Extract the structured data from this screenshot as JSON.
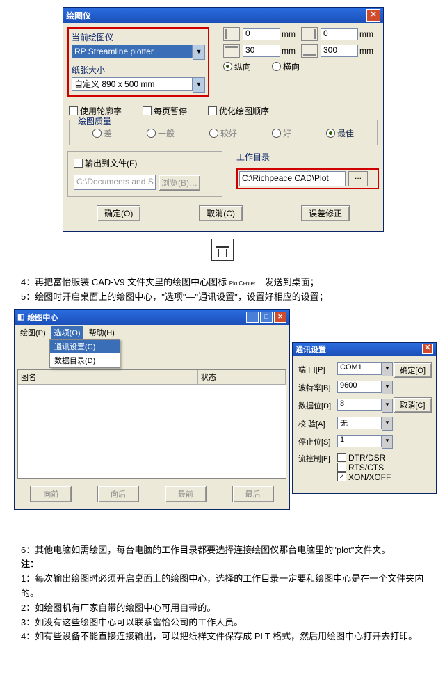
{
  "dlg1": {
    "title": "绘图仪",
    "plotter_label": "当前绘图仪",
    "plotter_value": "RP Streamline plotter",
    "paper_label": "纸张大小",
    "paper_value": "自定义 890 x 500 mm",
    "m_left": "0",
    "m_right": "0",
    "m_top": "30",
    "m_bot": "300",
    "unit": "mm",
    "orient_v": "纵向",
    "orient_h": "横向",
    "chk_outline": "使用轮廓字",
    "chk_pagepause": "每页暂停",
    "chk_optimize": "优化绘图顺序",
    "group_quality": "绘图质量",
    "q_bad": "差",
    "q_avg": "一般",
    "q_fair": "较好",
    "q_good": "好",
    "q_best": "最佳",
    "output_file": "输出到文件(F)",
    "output_path": "C:\\Documents and S…",
    "browse": "浏览(B)…",
    "workdir_label": "工作目录",
    "workdir_value": "C:\\Richpeace CAD\\Plot",
    "browse_dots": "...",
    "ok": "确定(O)",
    "cancel": "取消(C)",
    "err_fix": "误差修正"
  },
  "doc": {
    "icon_caption": "PlotCenter",
    "step4": "4：再把富怡服装 CAD-V9 文件夹里的绘图中心图标",
    "step4_end": "发送到桌面；",
    "step5": "5：绘图时开启桌面上的绘图中心，\"选项\"—\"通讯设置\"，设置好相应的设置；",
    "step6": "6：其他电脑如需绘图，每台电脑的工作目录都要选择连接绘图仪那台电脑里的\"plot\"文件夹。",
    "note_hdr": "注：",
    "n1": "1：每次输出绘图时必须开启桌面上的绘图中心，选择的工作目录一定要和绘图中心是在一个文件夹内的。",
    "n2": "2：如绘图机有厂家自带的绘图中心可用自带的。",
    "n3": "3：如没有这些绘图中心可以联系富怡公司的工作人员。",
    "n4": "4：如有些设备不能直接连接输出，可以把纸样文件保存成 PLT 格式，然后用绘图中心打开去打印。"
  },
  "dlg2": {
    "title": "绘图中心",
    "menu_plot": "绘图(P)",
    "menu_option": "选项(O)",
    "menu_help": "帮助(H)",
    "drop_comm": "通讯设置(C)",
    "drop_data": "数据目录(D)",
    "col_name": "图名",
    "col_status": "状态",
    "btn_up": "向前",
    "btn_down": "向后",
    "btn_top": "最前",
    "btn_bot": "最后"
  },
  "dlg3": {
    "title": "通讯设置",
    "port_l": "端 口[P]",
    "port_v": "COM1",
    "baud_l": "波特率[B]",
    "baud_v": "9600",
    "data_l": "数据位[D]",
    "data_v": "8",
    "parity_l": "校 验[A]",
    "parity_v": "无",
    "stop_l": "停止位[S]",
    "stop_v": "1",
    "flow_l": "流控制[F]",
    "fc1": "DTR/DSR",
    "fc2": "RTS/CTS",
    "fc3": "XON/XOFF",
    "ok": "确定[O]",
    "cancel": "取消[C]"
  }
}
